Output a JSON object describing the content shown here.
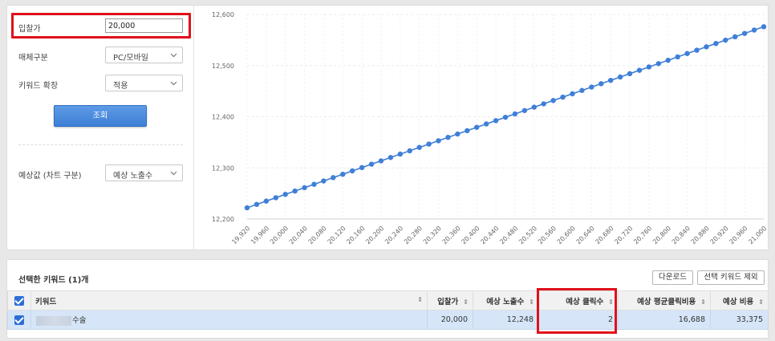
{
  "form": {
    "bid_label": "입찰가",
    "bid_value": "20,000",
    "media_label": "매체구분",
    "media_value": "PC/모바일",
    "keyword_expand_label": "키워드 확장",
    "keyword_expand_value": "적용",
    "search_button": "조회",
    "estimate_label": "예상값 (차트 구분)",
    "estimate_value": "예상 노출수"
  },
  "chart_data": {
    "type": "line",
    "x_ticks": [
      "19,920",
      "19,960",
      "20,000",
      "20,040",
      "20,080",
      "20,120",
      "20,160",
      "20,200",
      "20,240",
      "20,280",
      "20,320",
      "20,360",
      "20,400",
      "20,440",
      "20,480",
      "20,520",
      "20,560",
      "20,600",
      "20,640",
      "20,680",
      "20,720",
      "20,760",
      "20,800",
      "20,840",
      "20,880",
      "20,920",
      "20,960",
      "21,000"
    ],
    "y_ticks": [
      "12,600",
      "12,500",
      "12,400",
      "12,300",
      "12,200"
    ],
    "x_range": [
      19920,
      21000
    ],
    "y_range": [
      12200,
      12600
    ],
    "grid": true,
    "series_color": "#3f7fd8",
    "x_step": 20,
    "y_start": 12222,
    "y_end": 12576
  },
  "keywords": {
    "title": "선택한 키워드 (1)개",
    "download_button": "다운로드",
    "remove_button": "선택 키워드 제외",
    "columns": [
      "키워드",
      "입찰가",
      "예상 노출수",
      "예상 클릭수",
      "예상 평균클릭비용",
      "예상 비용"
    ],
    "rows": [
      {
        "keyword_suffix": "수술",
        "bid": "20,000",
        "impressions": "12,248",
        "clicks": "2",
        "avg_cpc": "16,688",
        "cost": "33,375"
      }
    ]
  }
}
